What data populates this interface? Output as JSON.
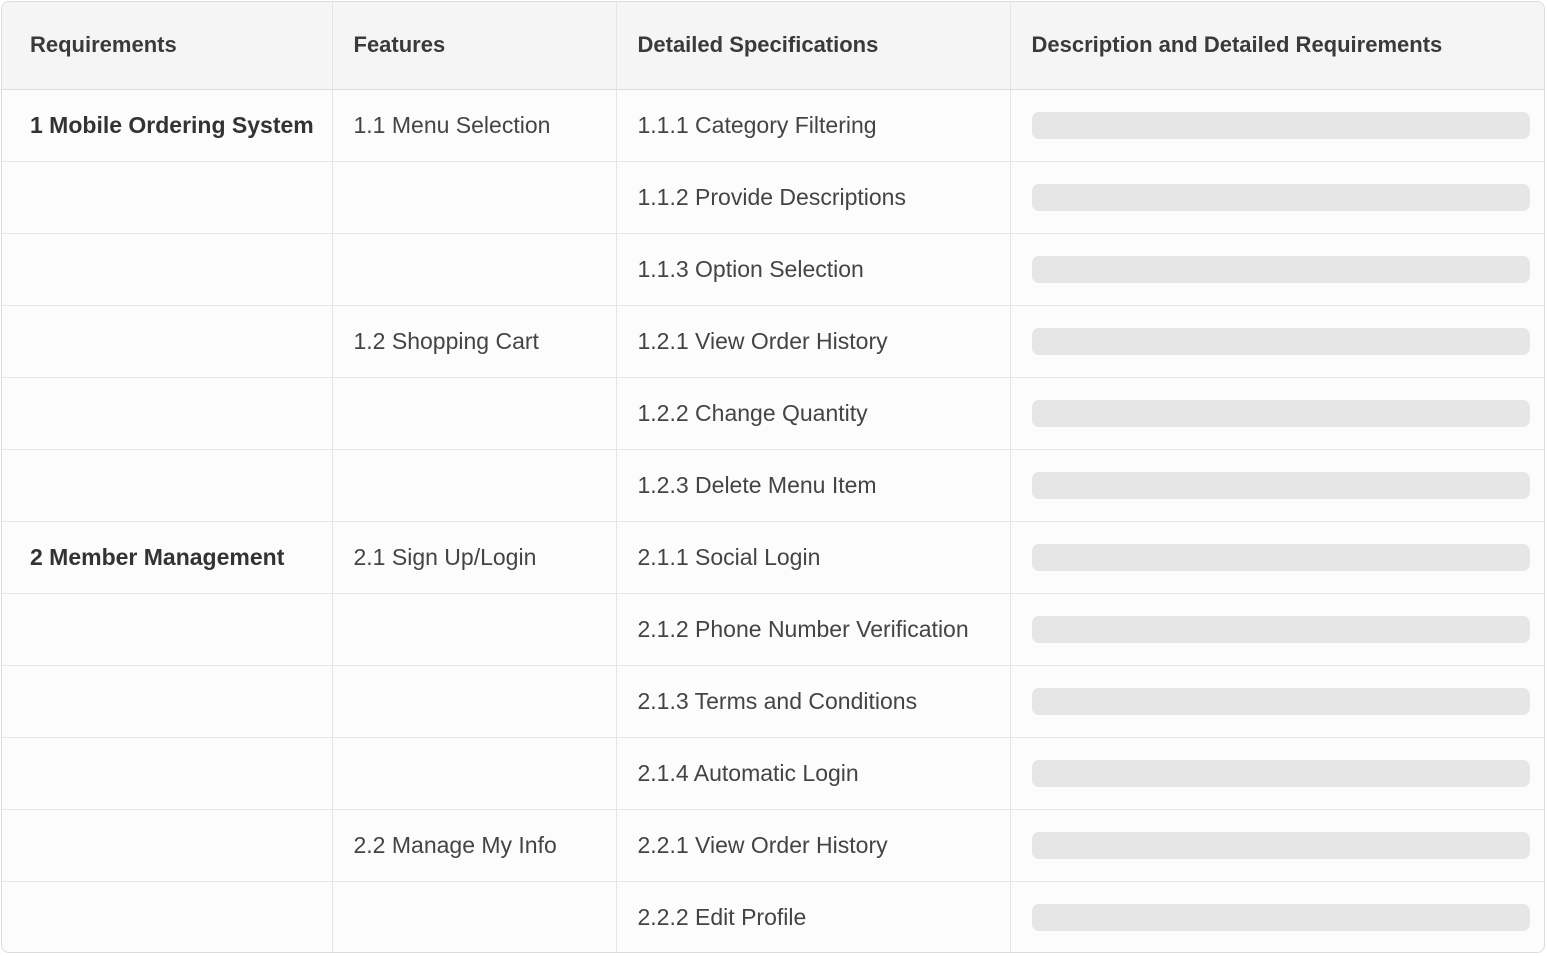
{
  "headers": {
    "requirements": "Requirements",
    "features": "Features",
    "specs": "Detailed Specifications",
    "description": "Description and Detailed Requirements"
  },
  "rows": [
    {
      "requirement": "1 Mobile Ordering System",
      "feature": "1.1 Menu Selection",
      "spec": "1.1.1 Category Filtering"
    },
    {
      "requirement": "",
      "feature": "",
      "spec": "1.1.2 Provide Descriptions"
    },
    {
      "requirement": "",
      "feature": "",
      "spec": "1.1.3 Option Selection"
    },
    {
      "requirement": "",
      "feature": "1.2 Shopping Cart",
      "spec": "1.2.1 View Order History"
    },
    {
      "requirement": "",
      "feature": "",
      "spec": "1.2.2 Change Quantity"
    },
    {
      "requirement": "",
      "feature": "",
      "spec": "1.2.3 Delete Menu Item"
    },
    {
      "requirement": "2 Member Management",
      "feature": "2.1 Sign Up/Login",
      "spec": "2.1.1 Social Login"
    },
    {
      "requirement": "",
      "feature": "",
      "spec": "2.1.2 Phone Number Verification"
    },
    {
      "requirement": "",
      "feature": "",
      "spec": "2.1.3 Terms and Conditions"
    },
    {
      "requirement": "",
      "feature": "",
      "spec": "2.1.4 Automatic Login"
    },
    {
      "requirement": "",
      "feature": "2.2 Manage My Info",
      "spec": "2.2.1 View Order History"
    },
    {
      "requirement": "",
      "feature": "",
      "spec": "2.2.2 Edit Profile"
    }
  ]
}
